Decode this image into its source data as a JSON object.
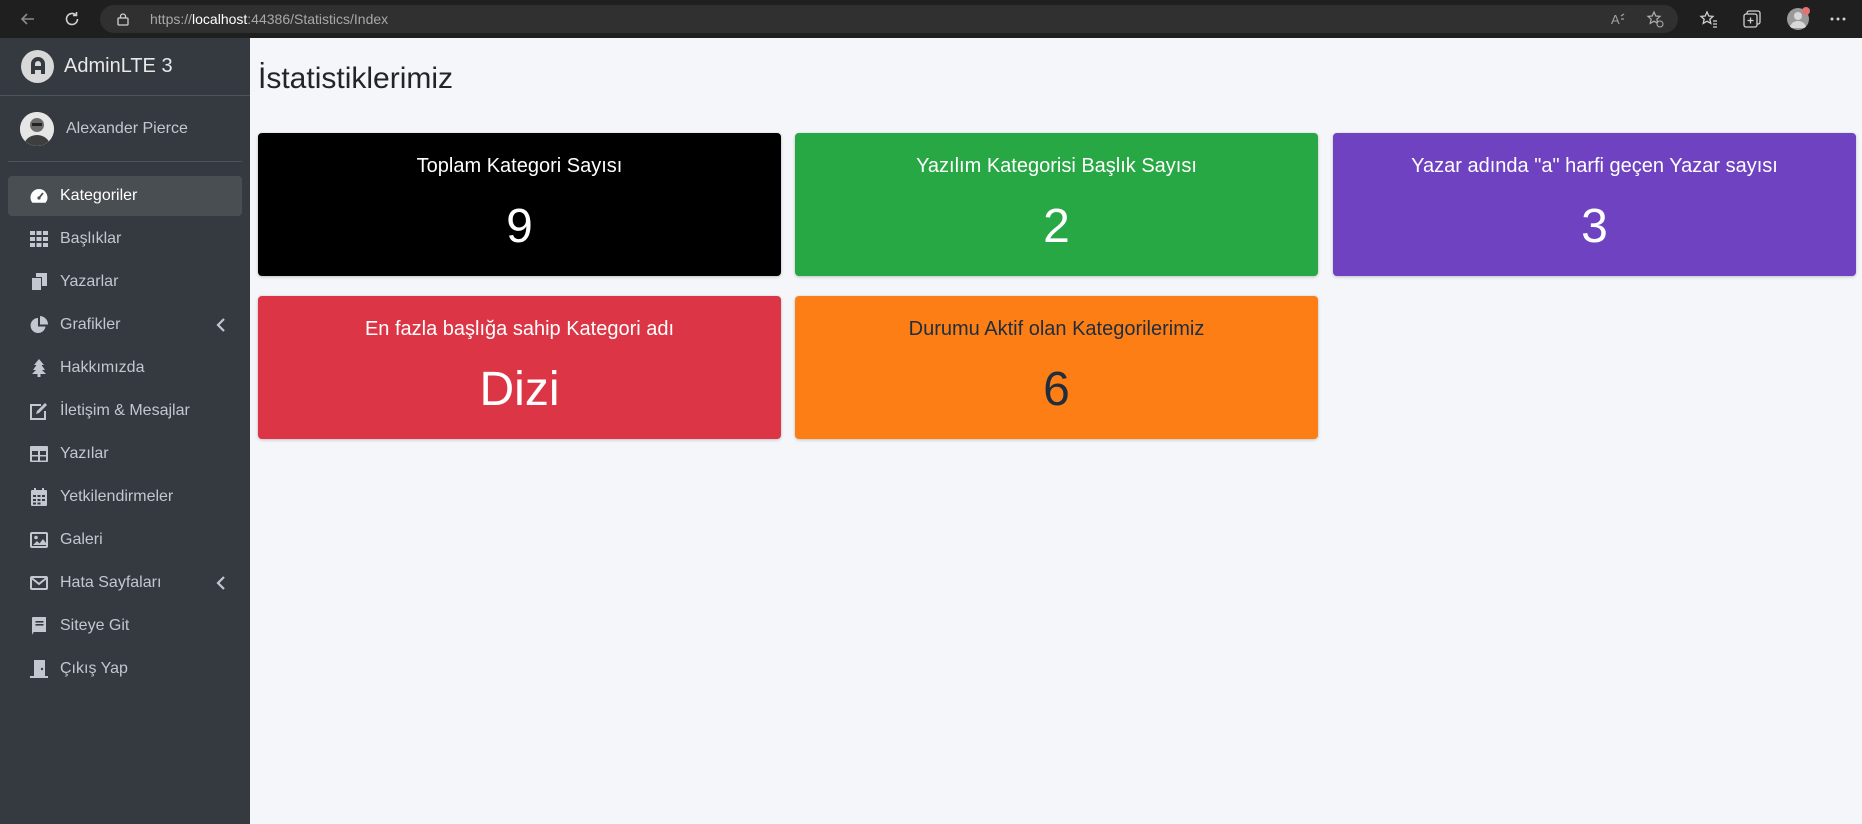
{
  "browser": {
    "url_prefix": "https://",
    "url_host": "localhost",
    "url_rest": ":44386/Statistics/Index"
  },
  "sidebar": {
    "brand": "AdminLTE 3",
    "user": "Alexander Pierce",
    "items": [
      {
        "label": "Kategoriler",
        "icon": "dashboard-icon"
      },
      {
        "label": "Başlıklar",
        "icon": "grid-icon"
      },
      {
        "label": "Yazarlar",
        "icon": "copy-icon"
      },
      {
        "label": "Grafikler",
        "icon": "pie-chart-icon"
      },
      {
        "label": "Hakkımızda",
        "icon": "tree-icon"
      },
      {
        "label": "İletişim & Mesajlar",
        "icon": "edit-icon"
      },
      {
        "label": "Yazılar",
        "icon": "table-icon"
      },
      {
        "label": "Yetkilendirmeler",
        "icon": "calendar-icon"
      },
      {
        "label": "Galeri",
        "icon": "image-icon"
      },
      {
        "label": "Hata Sayfaları",
        "icon": "envelope-icon"
      },
      {
        "label": "Siteye Git",
        "icon": "book-icon"
      },
      {
        "label": "Çıkış Yap",
        "icon": "door-icon"
      }
    ]
  },
  "main": {
    "title": "İstatistiklerimiz",
    "cards": [
      {
        "label": "Toplam Kategori Sayısı",
        "value": "9",
        "color": "#000000"
      },
      {
        "label": "Yazılım Kategorisi Başlık Sayısı",
        "value": "2",
        "color": "#28a745"
      },
      {
        "label": "Yazar adında \"a\" harfi geçen Yazar sayısı",
        "value": "3",
        "color": "#6f42c1"
      },
      {
        "label": "En fazla başlığa sahip Kategori adı",
        "value": "Dizi",
        "color": "#dc3545"
      },
      {
        "label": "Durumu Aktif olan Kategorilerimiz",
        "value": "6",
        "color": "#fd7e14"
      }
    ]
  }
}
